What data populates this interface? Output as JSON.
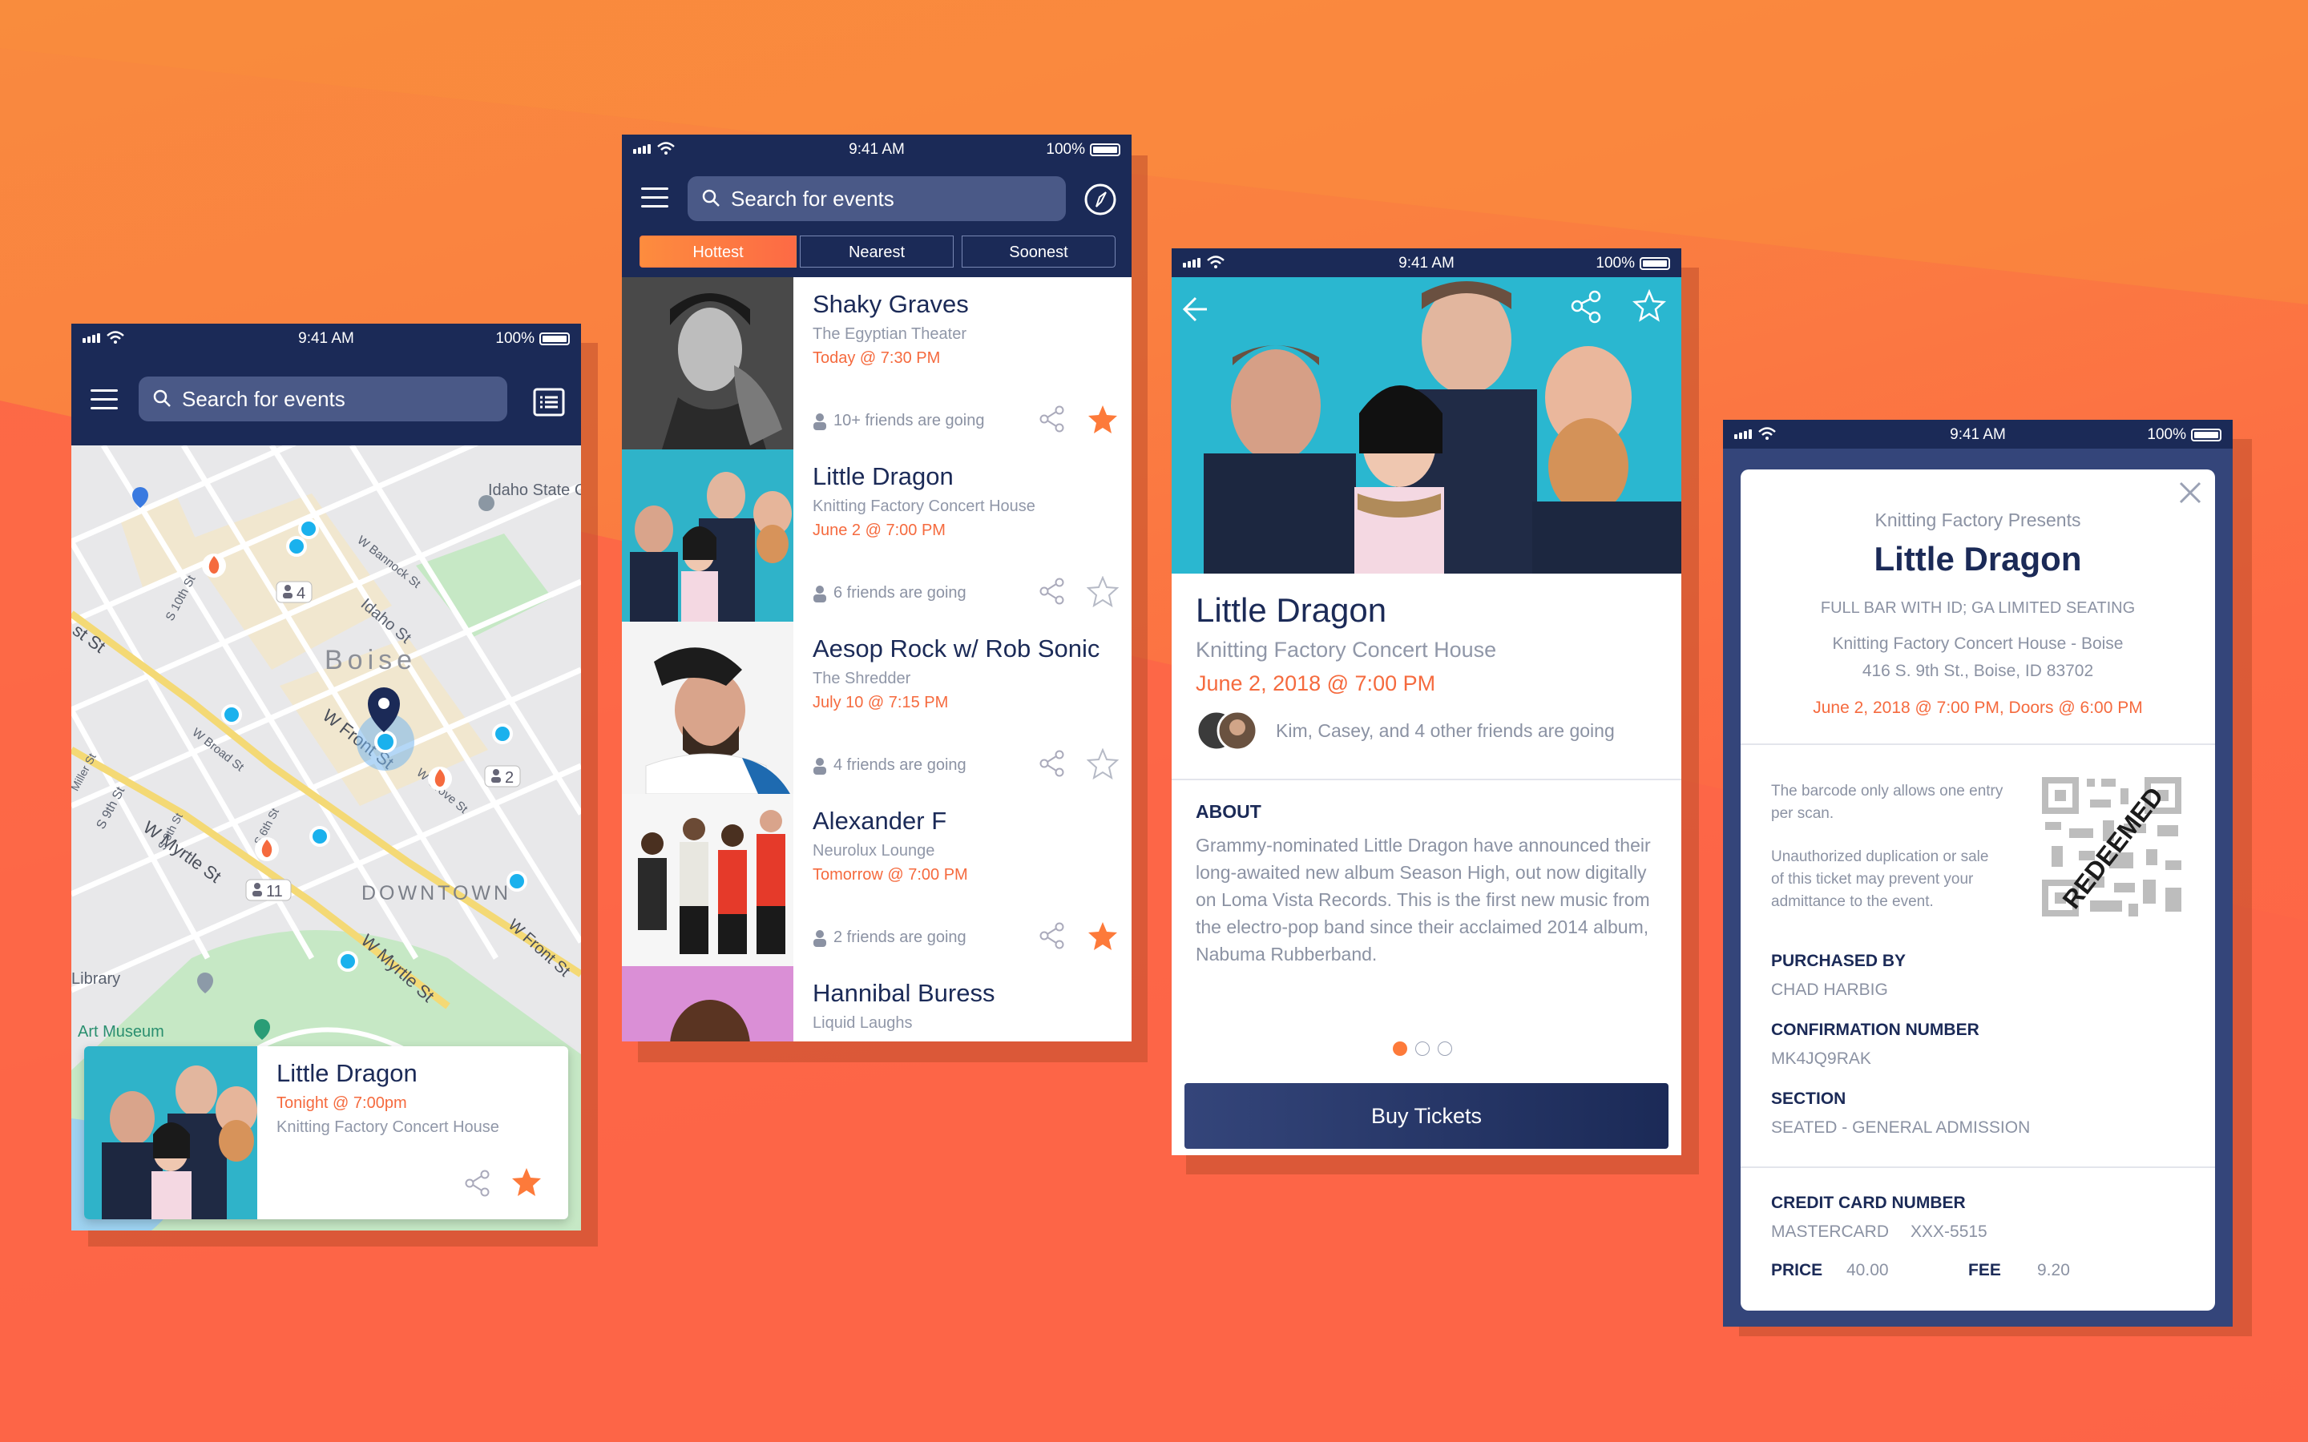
{
  "colors": {
    "navy": "#1b2a57",
    "orange": "#fd6a45",
    "accent_date": "#f56a3e",
    "map_water": "#9ed2f0",
    "map_park": "#c6e8c5",
    "map_road": "#f4d975"
  },
  "status_bar": {
    "time": "9:41 AM",
    "battery": "100%"
  },
  "map_screen": {
    "search_placeholder": "Search for events",
    "labels": {
      "idaho_state_capitol": "Idaho State Capitol Bu",
      "boise": "Boise",
      "downtown": "DOWNTOWN",
      "library": "Library",
      "art_museum": "Art Museum",
      "w_bannock": "W Bannock St",
      "idaho_st": "Idaho St",
      "s_10th": "S 10th St",
      "w_broad": "W Broad St",
      "w_front": "W Front St",
      "w_grove": "W Grove St",
      "w_myrtle": "W Myrtle St",
      "s_9th": "S 9th St",
      "s_8th": "S 8th St",
      "s_6th": "S 6th St",
      "w_myrtle2": "W Myrtle St",
      "w_front2": "W Front St",
      "st_left": "st St",
      "miller": "Miller St"
    },
    "clusters": [
      "4",
      "2",
      "11"
    ],
    "card": {
      "title": "Little Dragon",
      "date": "Tonight @ 7:00pm",
      "venue": "Knitting Factory Concert House",
      "starred": true
    }
  },
  "list_screen": {
    "search_placeholder": "Search for events",
    "tabs": [
      "Hottest",
      "Nearest",
      "Soonest"
    ],
    "active_tab": "Hottest",
    "events": [
      {
        "title": "Shaky Graves",
        "venue": "The Egyptian Theater",
        "date": "Today @ 7:30 PM",
        "friends": "10+ friends are going",
        "starred": true
      },
      {
        "title": "Little Dragon",
        "venue": "Knitting Factory Concert House",
        "date": "June 2 @ 7:00 PM",
        "friends": "6 friends are going",
        "starred": false
      },
      {
        "title": "Aesop Rock w/ Rob Sonic",
        "venue": "The Shredder",
        "date": "July 10 @ 7:15 PM",
        "friends": "4 friends are going",
        "starred": false
      },
      {
        "title": "Alexander F",
        "venue": "Neurolux Lounge",
        "date": "Tomorrow @ 7:00 PM",
        "friends": "2 friends are going",
        "starred": true
      },
      {
        "title": "Hannibal Buress",
        "venue": "Liquid Laughs",
        "date": "",
        "friends": "",
        "starred": false
      }
    ]
  },
  "detail_screen": {
    "title": "Little Dragon",
    "venue": "Knitting Factory Concert House",
    "date": "June 2, 2018 @ 7:00 PM",
    "friends": "Kim, Casey, and 4 other friends are going",
    "about_heading": "ABOUT",
    "about_text": "Grammy-nominated Little Dragon have announced their long-awaited new album Season High, out now digitally on Loma Vista Records. This is the first new music from the electro-pop band since their acclaimed 2014 album, Nabuma Rubberband.",
    "page_dots": 3,
    "active_dot": 0,
    "buy_button": "Buy Tickets"
  },
  "ticket_screen": {
    "presenter": "Knitting Factory Presents",
    "title": "Little Dragon",
    "subtitle": "FULL BAR WITH ID; GA LIMITED SEATING",
    "venue_line1": "Knitting Factory Concert House - Boise",
    "venue_line2": "416 S. 9th St., Boise, ID 83702",
    "date": "June 2, 2018 @ 7:00 PM, Doors @ 6:00 PM",
    "barcode_note1": "The barcode only allows one entry per scan.",
    "barcode_note2": "Unauthorized duplication or sale of this ticket may prevent your admittance to the event.",
    "stamp": "REDEEMED",
    "purchased_by_label": "PURCHASED BY",
    "purchased_by": "CHAD HARBIG",
    "confirmation_label": "CONFIRMATION NUMBER",
    "confirmation": "MK4JQ9RAK",
    "section_label": "SECTION",
    "section": "SEATED - GENERAL ADMISSION",
    "credit_label": "CREDIT CARD NUMBER",
    "card_type": "MASTERCARD",
    "card_number": "XXX-5515",
    "price_label": "PRICE",
    "price": "40.00",
    "fee_label": "FEE",
    "fee": "9.20"
  }
}
